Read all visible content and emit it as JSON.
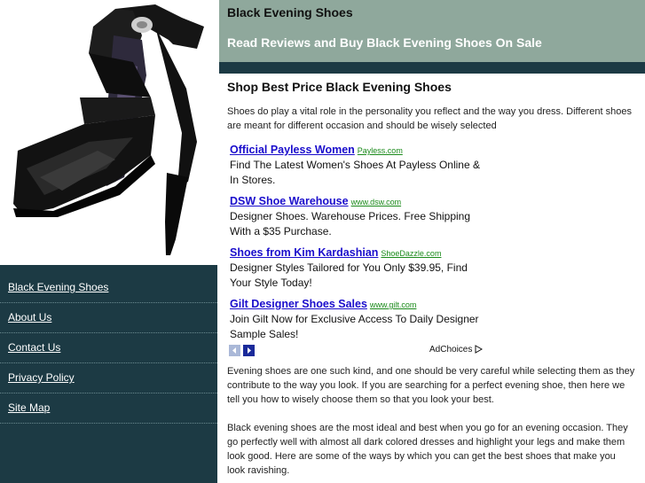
{
  "header": {
    "title": "Black Evening Shoes",
    "tagline": "Read Reviews and Buy Black Evening Shoes On Sale"
  },
  "sidebar": {
    "items": [
      {
        "label": "Black Evening Shoes"
      },
      {
        "label": "About Us"
      },
      {
        "label": "Contact Us"
      },
      {
        "label": "Privacy Policy"
      },
      {
        "label": "Site Map"
      }
    ]
  },
  "main": {
    "heading": "Shop Best Price Black Evening Shoes",
    "intro": "Shoes do play a vital role in the personality you reflect and the way you dress. Different shoes are meant for different occasion and should be wisely selected",
    "para1": "Evening shoes are one such kind, and one should be very careful while selecting them as they contribute to the way you look. If you are searching for a perfect evening shoe, then here we tell you how to wisely choose them so that you look your best.",
    "para2": "Black evening shoes are the most ideal and best when you go for an evening occasion. They go perfectly well with almost all dark colored dresses and highlight your legs and make them look good. Here are some of the ways by which you can get the best shoes that make you look ravishing."
  },
  "ads": {
    "items": [
      {
        "title": "Official Payless Women",
        "url": "Payless.com",
        "desc": "Find The Latest Women's Shoes At Payless Online & In Stores."
      },
      {
        "title": "DSW Shoe Warehouse",
        "url": "www.dsw.com",
        "desc": "Designer Shoes. Warehouse Prices. Free Shipping With a $35 Purchase."
      },
      {
        "title": "Shoes from Kim Kardashian",
        "url": "ShoeDazzle.com",
        "desc": "Designer Styles Tailored for You Only $39.95, Find Your Style Today!"
      },
      {
        "title": "Gilt Designer Shoes Sales",
        "url": "www.gilt.com",
        "desc": "Join Gilt Now for Exclusive Access To Daily Designer Sample Sales!"
      }
    ],
    "adchoices_label": "AdChoices"
  },
  "colors": {
    "header_bg": "#8fa89c",
    "nav_bg": "#1c3a44",
    "ad_link": "#1a0dcc",
    "ad_url": "#1a8a1a"
  }
}
